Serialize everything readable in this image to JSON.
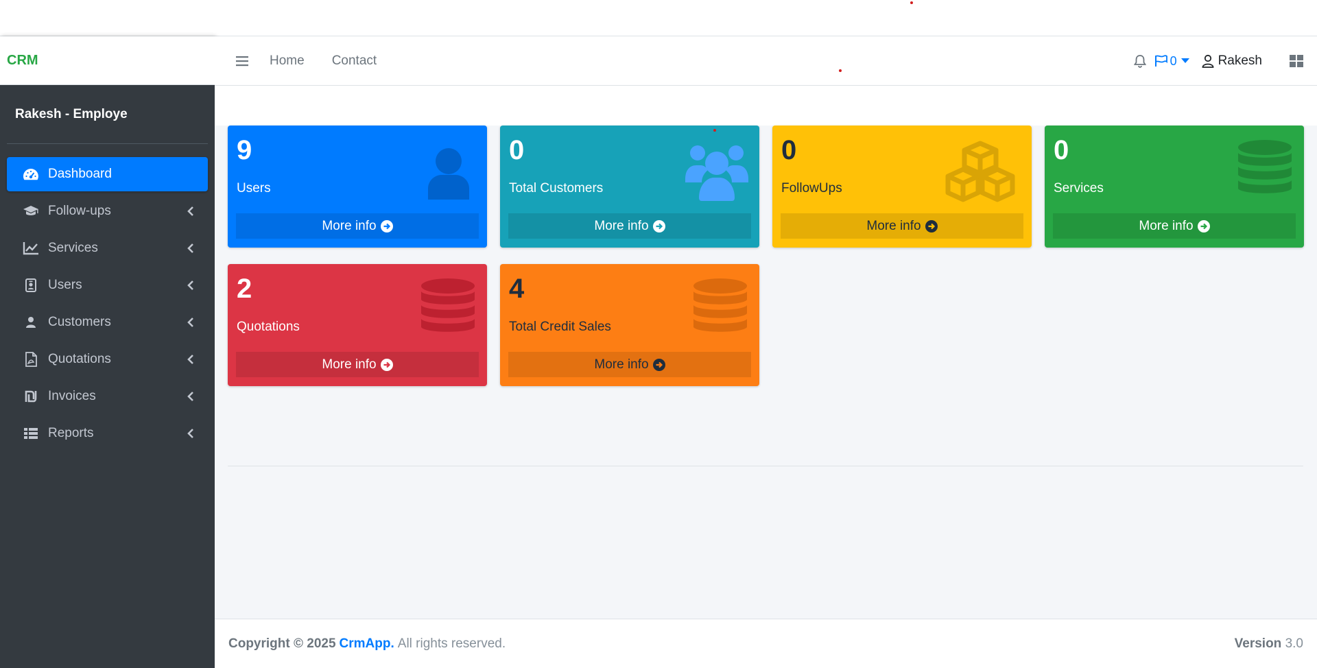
{
  "brand": "CRM",
  "sidebar": {
    "user": "Rakesh - Employe",
    "items": [
      {
        "label": "Dashboard",
        "icon": "dashboard-icon"
      },
      {
        "label": "Follow-ups",
        "icon": "graduation-cap-icon"
      },
      {
        "label": "Services",
        "icon": "chart-line-icon"
      },
      {
        "label": "Users",
        "icon": "id-badge-icon"
      },
      {
        "label": "Customers",
        "icon": "user-icon"
      },
      {
        "label": "Quotations",
        "icon": "file-pdf-icon"
      },
      {
        "label": "Invoices",
        "icon": "shekel-icon"
      },
      {
        "label": "Reports",
        "icon": "table-list-icon"
      }
    ]
  },
  "header": {
    "home": "Home",
    "contact": "Contact",
    "flag_count": "0",
    "user_name": "Rakesh"
  },
  "boxes": [
    {
      "value": "9",
      "label": "Users",
      "more": "More info",
      "color": "#007bff",
      "icon": "user-icon"
    },
    {
      "value": "0",
      "label": "Total Customers",
      "more": "More info",
      "color": "#17a2b8",
      "icon": "users-icon"
    },
    {
      "value": "0",
      "label": "FollowUps",
      "more": "More info",
      "color": "#ffc107",
      "icon": "cubes-icon"
    },
    {
      "value": "0",
      "label": "Services",
      "more": "More info",
      "color": "#28a745",
      "icon": "database-icon"
    },
    {
      "value": "2",
      "label": "Quotations",
      "more": "More info",
      "color": "#dc3545",
      "icon": "database-icon"
    },
    {
      "value": "4",
      "label": "Total Credit Sales",
      "more": "More info",
      "color": "#fd7e14",
      "icon": "database-icon"
    }
  ],
  "footer": {
    "copyright": "Copyright © 2025",
    "brand": "CrmApp.",
    "rights": "All rights reserved.",
    "version_label": "Version",
    "version": "3.0"
  }
}
